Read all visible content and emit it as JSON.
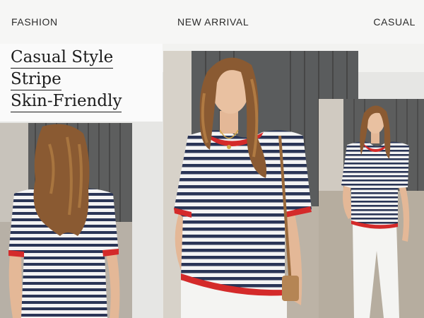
{
  "header": {
    "tags": [
      "FASHION",
      "NEW ARRIVAL",
      "CASUAL"
    ]
  },
  "headline": {
    "lines": [
      "Casual Style",
      "Stripe",
      "Skin-Friendly"
    ]
  },
  "photos": [
    {
      "name": "back-view-photo",
      "subject": "woman back view striped tee"
    },
    {
      "name": "front-view-photo",
      "subject": "woman front view striped tee with red trim"
    },
    {
      "name": "full-body-photo",
      "subject": "woman full body striped tee and white jeans"
    }
  ],
  "colors": {
    "stripe_navy": "#2a3556",
    "trim_red": "#d42a2a",
    "hair": "#8a5a32",
    "skin": "#e4b897",
    "jeans": "#f4f4f2"
  }
}
